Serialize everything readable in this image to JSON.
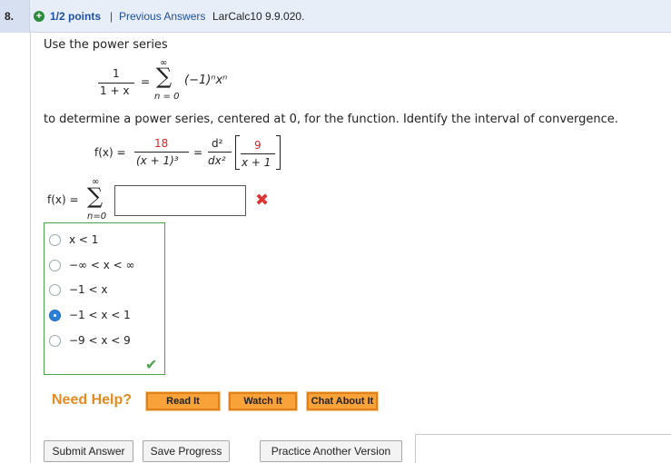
{
  "header": {
    "question_number": "8.",
    "points": "1/2 points",
    "separator": "|",
    "previous_answers": "Previous Answers",
    "course_id": "LarCalc10 9.9.020."
  },
  "problem": {
    "intro": "Use the power series",
    "series_numerator": "1",
    "series_denominator": "1 + x",
    "equals": "=",
    "sigma": "∑",
    "sigma_top": "∞",
    "sigma_bottom": "n = 0",
    "series_term": "(−1)ⁿxⁿ",
    "instruction": "to determine a power series, centered at 0, for the function. Identify the interval of convergence.",
    "fx_label": "f(x) =",
    "f_numerator": "18",
    "f_denominator": "(x + 1)³",
    "deriv_numerator": "d²",
    "deriv_denominator": "dx²",
    "inner_numerator": "9",
    "inner_denominator": "x + 1"
  },
  "answer": {
    "fx_label": "f(x) =",
    "sigma": "∑",
    "sigma_top": "∞",
    "sigma_bottom": "n=0",
    "value": "",
    "status_icon": "x-icon"
  },
  "choices": [
    {
      "label": "x < 1",
      "selected": false
    },
    {
      "label": "−∞ < x < ∞",
      "selected": false
    },
    {
      "label": "−1 < x",
      "selected": false
    },
    {
      "label": "−1 < x < 1",
      "selected": true
    },
    {
      "label": "−9 < x < 9",
      "selected": false
    }
  ],
  "help": {
    "title": "Need Help?",
    "read": "Read It",
    "watch": "Watch It",
    "chat": "Chat About It"
  },
  "buttons": {
    "submit": "Submit Answer",
    "save": "Save Progress",
    "practice": "Practice Another Version"
  },
  "colors": {
    "accent_blue": "#1f4fa0",
    "correct_green": "#4aa34a",
    "wrong_red": "#d33333",
    "help_orange": "#f9a23a"
  }
}
